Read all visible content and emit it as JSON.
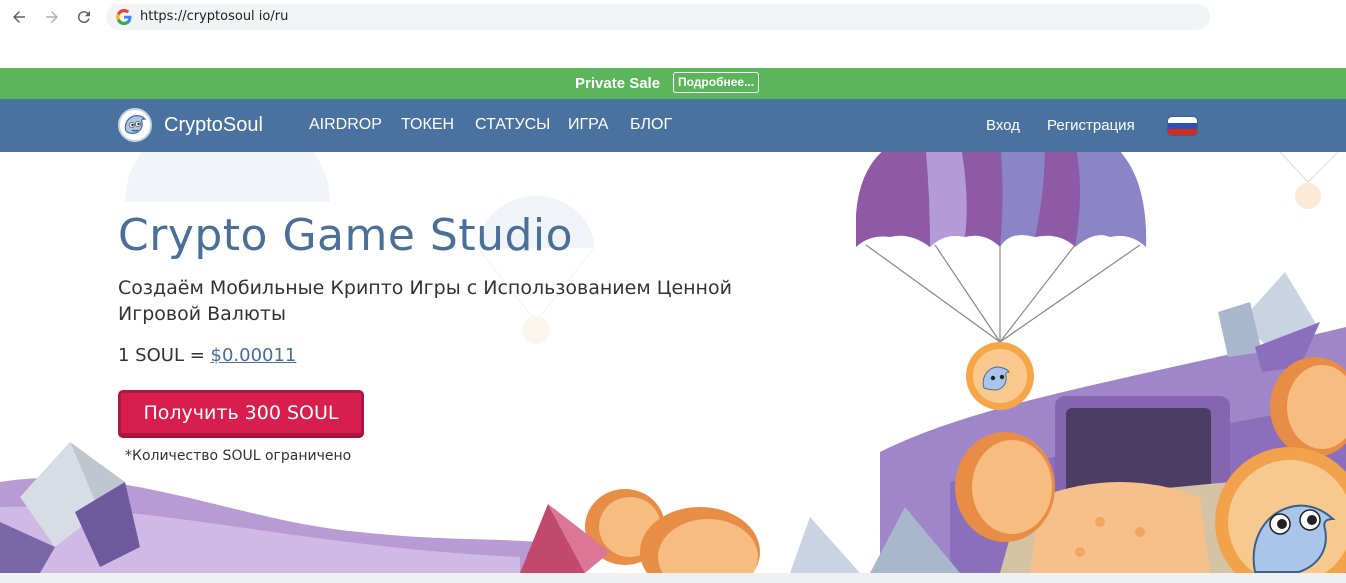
{
  "browser": {
    "url": "https://cryptosoul io/ru",
    "icons": [
      "back-arrow-icon",
      "forward-arrow-icon",
      "reload-icon",
      "google-icon"
    ]
  },
  "sale_bar": {
    "label": "Private Sale",
    "button": "Подробнее...",
    "color": "#5bb55a"
  },
  "header": {
    "brand": "CryptoSoul",
    "menu": [
      "AIRDROP",
      "ТОКЕН",
      "СТАТУСЫ",
      "ИГРА",
      "БЛОГ"
    ],
    "login": "Вход",
    "register": "Регистрация",
    "language_flag": "russia-flag-icon",
    "color": "#4a72a0"
  },
  "hero": {
    "title": "Crypto Game Studio",
    "subtitle": "Создаём Мобильные Крипто Игры с Использованием Ценной Игровой Валюты",
    "price_prefix": "1 SOUL = ",
    "price_value": "$0.00011",
    "cta": "Получить 300 SOUL",
    "note": "*Количество SOUL ограничено",
    "cta_color": "#d81e4c"
  }
}
